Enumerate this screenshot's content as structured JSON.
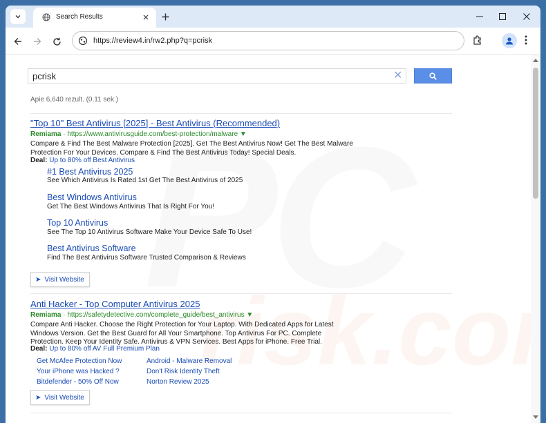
{
  "tab": {
    "title": "Search Results"
  },
  "omnibox": {
    "url": "https://review4.in/rw2.php?q=pcrisk"
  },
  "search": {
    "query": "pcrisk",
    "stats": "Apie 6,640 rezult. (0.11 sek.)"
  },
  "results": [
    {
      "title": "\"Top 10\" Best Antivirus [2025] - Best Antivirus (Recommended)",
      "label": "Remiama",
      "url": "https://www.antivirusguide.com/best-protection/malware ▼",
      "desc": "Compare & Find The Best Malware Protection [2025]. Get The Best Antivirus Now! Get The Best Malware Protection For Your Devices. Compare & Find The Best Antivirus Today! Special Deals.",
      "deal_label": "Deal:",
      "deal_value": "Up to 80% off Best Antivirus",
      "sitelinks": [
        {
          "title": "#1 Best Antivirus 2025",
          "desc": "See Which Antivirus Is Rated 1st Get The Best Antivirus of 2025"
        },
        {
          "title": "Best Windows Antivirus",
          "desc": "Get The Best Windows Antivirus That Is Right For You!"
        },
        {
          "title": "Top 10 Antivirus",
          "desc": "See The Top 10 Antivirus Software Make Your Device Safe To Use!"
        },
        {
          "title": "Best Antivirus Software",
          "desc": "Find The Best Antivirus Software Trusted Comparison & Reviews"
        }
      ],
      "visit_label": "Visit Website"
    },
    {
      "title": "Anti Hacker - Top Computer Antivirus 2025",
      "label": "Remiama",
      "url": "https://safetydetective.com/complete_guide/best_antivirus ▼",
      "desc": "Compare Anti Hacker. Choose the Right Protection for Your Laptop. With Dedicated Apps for Latest Windows Version. Get the Best Guard for All Your Smartphone. Top Antivirus For PC. Complete Protection. Keep Your Identity Safe. Antivirus & VPN Services. Best Apps for iPhone. Free Trial.",
      "deal_label": "Deal:",
      "deal_value": "Up to 80% off AV Full Premium Plan",
      "links": [
        "Get McAfee Protection Now",
        "Android - Malware Removal",
        "Your iPhone was Hacked ?",
        "Don't Risk Identity Theft",
        "Bitdefender - 50% Off Now",
        "Norton Review 2025"
      ],
      "visit_label": "Visit Website"
    }
  ],
  "colors": {
    "link": "#1a4bb5",
    "url_green": "#2a8a2a",
    "search_button": "#5b8ee6",
    "tabstrip": "#dee9f8"
  }
}
